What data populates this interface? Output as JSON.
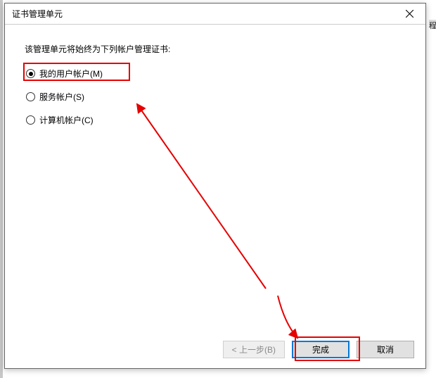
{
  "window": {
    "title": "证书管理单元"
  },
  "content": {
    "instruction": "该管理单元将始终为下列帐户管理证书:",
    "options": {
      "user": "我的用户帐户(M)",
      "service": "服务帐户(S)",
      "computer": "计算机帐户(C)"
    }
  },
  "buttons": {
    "back": "< 上一步(B)",
    "finish": "完成",
    "cancel": "取消"
  },
  "edge_hint": "程"
}
